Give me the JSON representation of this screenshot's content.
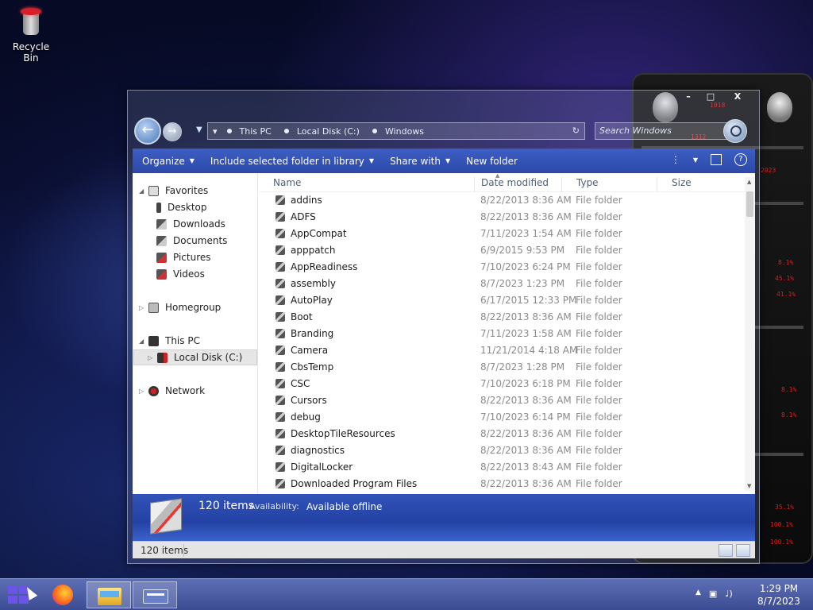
{
  "desktop": {
    "recycle_bin_label": "Recycle Bin"
  },
  "gadget": {
    "readouts": [
      "1018",
      "1312",
      "2023",
      "8.1%",
      "45.1%",
      "41.1%",
      "8.1%",
      "8.1%",
      "35.1%",
      "100.1%",
      "100.1%"
    ]
  },
  "window": {
    "controls": {
      "minimize": "–",
      "maximize": "□",
      "close": "X"
    },
    "breadcrumbs": [
      "This PC",
      "Local Disk (C:)",
      "Windows"
    ],
    "search_placeholder": "Search Windows",
    "toolbar": {
      "organize": "Organize",
      "include": "Include selected folder in library",
      "share": "Share with",
      "new_folder": "New folder",
      "help": "?"
    },
    "navpane": {
      "favorites": "Favorites",
      "desktop": "Desktop",
      "downloads": "Downloads",
      "documents": "Documents",
      "pictures": "Pictures",
      "videos": "Videos",
      "homegroup": "Homegroup",
      "this_pc": "This PC",
      "local_disk": "Local Disk (C:)",
      "network": "Network"
    },
    "columns": {
      "name": "Name",
      "date": "Date modified",
      "type": "Type",
      "size": "Size"
    },
    "rows": [
      {
        "name": "addins",
        "date": "8/22/2013 8:36 AM",
        "type": "File folder"
      },
      {
        "name": "ADFS",
        "date": "8/22/2013 8:36 AM",
        "type": "File folder"
      },
      {
        "name": "AppCompat",
        "date": "7/11/2023 1:54 AM",
        "type": "File folder"
      },
      {
        "name": "apppatch",
        "date": "6/9/2015 9:53 PM",
        "type": "File folder"
      },
      {
        "name": "AppReadiness",
        "date": "7/10/2023 6:24 PM",
        "type": "File folder"
      },
      {
        "name": "assembly",
        "date": "8/7/2023 1:23 PM",
        "type": "File folder"
      },
      {
        "name": "AutoPlay",
        "date": "6/17/2015 12:33 PM",
        "type": "File folder"
      },
      {
        "name": "Boot",
        "date": "8/22/2013 8:36 AM",
        "type": "File folder"
      },
      {
        "name": "Branding",
        "date": "7/11/2023 1:58 AM",
        "type": "File folder"
      },
      {
        "name": "Camera",
        "date": "11/21/2014 4:18 AM",
        "type": "File folder"
      },
      {
        "name": "CbsTemp",
        "date": "8/7/2023 1:28 PM",
        "type": "File folder"
      },
      {
        "name": "CSC",
        "date": "7/10/2023 6:18 PM",
        "type": "File folder"
      },
      {
        "name": "Cursors",
        "date": "8/22/2013 8:36 AM",
        "type": "File folder"
      },
      {
        "name": "debug",
        "date": "7/10/2023 6:14 PM",
        "type": "File folder"
      },
      {
        "name": "DesktopTileResources",
        "date": "8/22/2013 8:36 AM",
        "type": "File folder"
      },
      {
        "name": "diagnostics",
        "date": "8/22/2013 8:36 AM",
        "type": "File folder"
      },
      {
        "name": "DigitalLocker",
        "date": "8/22/2013 8:43 AM",
        "type": "File folder"
      },
      {
        "name": "Downloaded Program Files",
        "date": "8/22/2013 8:36 AM",
        "type": "File folder"
      }
    ],
    "details": {
      "count": "120 items",
      "availability_label": "Availability:",
      "availability_value": "Available offline"
    },
    "status_count": "120 items"
  },
  "taskbar": {
    "time": "1:29 PM",
    "date": "8/7/2023"
  }
}
